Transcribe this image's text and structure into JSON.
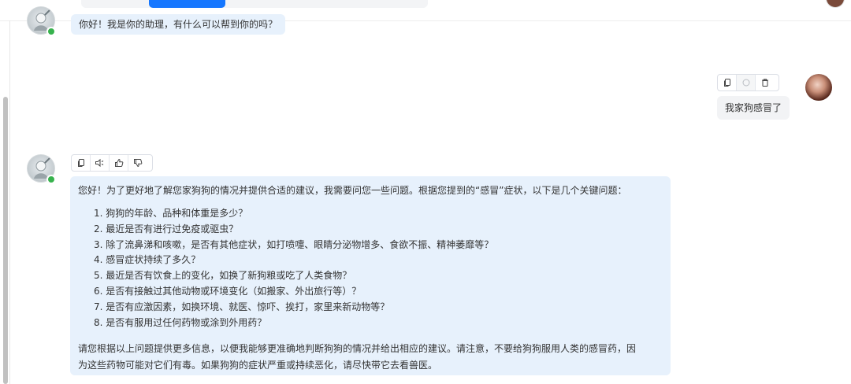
{
  "conversation": {
    "greeting": {
      "text": "你好！我是你的助理，有什么可以帮到你的吗？"
    },
    "user_message": {
      "text": "我家狗感冒了",
      "actions": [
        {
          "name": "copy-icon",
          "enabled": true
        },
        {
          "name": "loading-icon",
          "enabled": false
        },
        {
          "name": "delete-icon",
          "enabled": true
        }
      ]
    },
    "assistant_reply": {
      "actions": [
        {
          "name": "copy-icon"
        },
        {
          "name": "speaker-icon"
        },
        {
          "name": "thumbs-up-icon"
        },
        {
          "name": "thumbs-down-icon"
        }
      ],
      "intro": "您好！为了更好地了解您家狗狗的情况并提供合适的建议，我需要问您一些问题。根据您提到的“感冒”症状，以下是几个关键问题：",
      "questions": [
        "1. 狗狗的年龄、品种和体重是多少？",
        "2. 最近是否有进行过免疫或驱虫？",
        "3. 除了流鼻涕和咳嗽，是否有其他症状，如打喷嚏、眼睛分泌物增多、食欲不振、精神萎靡等？",
        "4. 感冒症状持续了多久？",
        "5. 最近是否有饮食上的变化，如换了新狗粮或吃了人类食物？",
        "6. 是否有接触过其他动物或环境变化（如搬家、外出旅行等）？",
        "7. 是否有应激因素，如换环境、就医、惊吓、挨打，家里来新动物等？",
        "8. 是否有服用过任何药物或涂到外用药？"
      ],
      "outro_line1": "请您根据以上问题提供更多信息，以便我能够更准确地判断狗狗的情况并给出相应的建议。请注意，不要给狗狗服用人类的感冒药，因",
      "outro_line2": "为这些药物可能对它们有毒。如果狗狗的症状严重或持续恶化，请尽快带它去看兽医。"
    }
  },
  "colors": {
    "assistant_bubble": "#e7f1fc",
    "user_bubble": "#f2f3f5",
    "online_status": "#37b24d",
    "accent": "#1677ff"
  }
}
